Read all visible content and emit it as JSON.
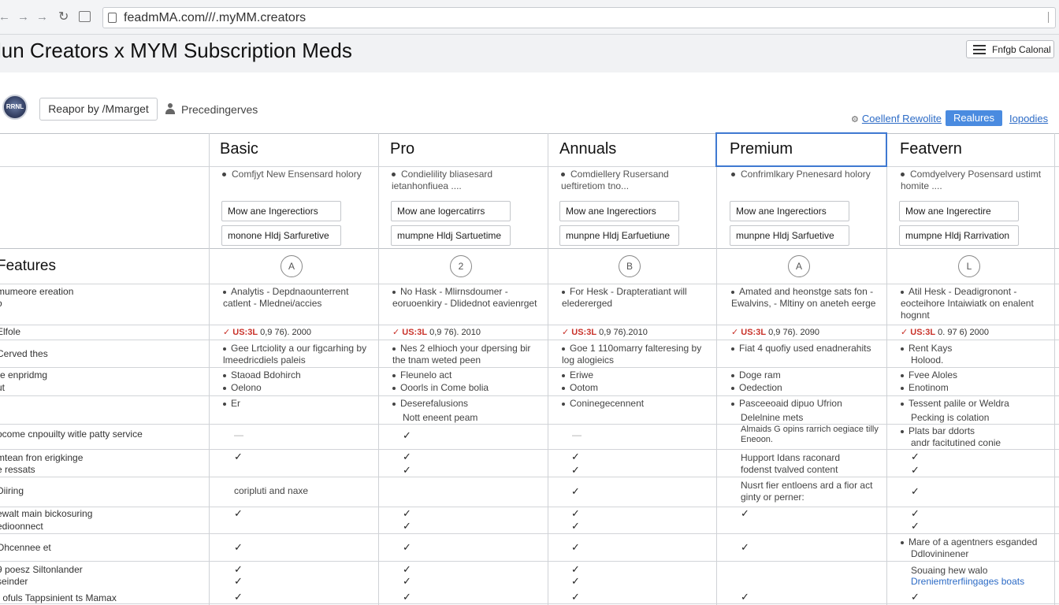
{
  "browser": {
    "url": "feadmMA.com///.myMM.creators",
    "nav_back": "←",
    "nav_forward": "→",
    "nav_forward2": "→",
    "nav_reload": "↻"
  },
  "header": {
    "title": "lun Creators x MYM Subscription Meds",
    "export_label": "Fnfgb Calonal"
  },
  "profile": {
    "avatar_text": "RRNL",
    "report_label": "Reapor by /Mmarget",
    "preceding_label": "Precedingerves"
  },
  "toolbar": {
    "link1": "Coellenf Rewolite",
    "features_tag": "Realures",
    "link3": "Iopodies"
  },
  "plans": [
    {
      "name": "Basic",
      "desc": "Comfjyt New Ensensard holory",
      "btn1": "Mow ane Ingerectiors",
      "btn2": "monone Hldj Sarfuretive",
      "badge": "A"
    },
    {
      "name": "Pro",
      "desc": "Condielility bliasesard ietanhonfiuea ....",
      "btn1": "Mow ane logercatirrs",
      "btn2": "mumpne Hldj Sartuetime",
      "badge": "2"
    },
    {
      "name": "Annuals",
      "desc": "Comdiellery Rusersand ueftiretiom tno...",
      "btn1": "Mow ane Ingerectiors",
      "btn2": "munpne Hldj Earfuetiune",
      "badge": "B"
    },
    {
      "name": "Premium",
      "desc": "Confrimlkary Pnenesard holory",
      "btn1": "Mow ane Ingerectiors",
      "btn2": "munpne Hldj Sarfuetive",
      "badge": "A"
    },
    {
      "name": "Featvern",
      "desc": "Comdyelvery Posensard ustimt homite ....",
      "btn1": "Mow ane Ingerectire",
      "btn2": "mumpne Hldj Rarrivation",
      "badge": "L"
    }
  ],
  "features_heading": "Features",
  "row_labels": [
    "mumeore ereation",
    "o",
    "Elfole",
    "Cerved thes",
    "re enpridmg",
    "ut",
    "ocome cnpouilty witle patty service",
    "mtean fron erigkinge",
    "e ressats",
    "Diiring",
    "ewalt main bickosuring",
    "edioonnect",
    "Ohcennee et",
    "9 poesz Siltonlander",
    "seinder",
    "r ofuls Tappsinient ts Mamax"
  ],
  "cells": {
    "basic": {
      "r1": "Analytis - Depdnaounterrent catlent - Mlednei/accies",
      "price_cur": "US:3L",
      "price_rest": "0,9 76). 2000",
      "r3": "Gee Lrtciolity a our figcarhing by lmeedricdiels paleis",
      "r4": "Staoad Bdohirch",
      "r5": "Oelono",
      "r6": "Er",
      "r7": "—",
      "r9": "coripluti and naxe"
    },
    "pro": {
      "r1": "No Hask - Mlirnsdoumer - eoruoenkiry - Dlidednot eavienrget",
      "price_cur": "US:3L",
      "price_rest": "0,9 76). 2010",
      "r3": "Nes 2 elhioch your dpersing bir the tnam weted peen",
      "r4": "Fleunelo act",
      "r5": "Ooorls in Come bolia",
      "r6": "Deserefalusions",
      "r6b": "Nott eneent peam",
      "r9": ""
    },
    "annuals": {
      "r1": "For Hesk - Drapteratiant will eledererged",
      "price_cur": "US:3L",
      "price_rest": "0,9 76).2010",
      "r3": "Goe 1 110omarry falteresing by log alogieics",
      "r4": "Eriwe",
      "r5": "Ootom",
      "r6": "Coninegecennent",
      "r7": "—"
    },
    "premium": {
      "r1": "Amated and heonstge sats fon - Ewalvins, - Mltiny on aneteh eerge",
      "price_cur": "US:3L",
      "price_rest": "0,9 76). 2090",
      "r3": "Fiat 4 quofiy used enadnerahits",
      "r4": "Doge ram",
      "r5": "Oedection",
      "r6": "Pasceeoaid dipuo Ufrion",
      "r6b": "Delelnine mets",
      "r7": "Almaids G opins rarrich oegiace tilly Eneoon.",
      "r8": "Hupport Idans raconard",
      "r8b": "fodenst tvalved content",
      "r9": "Nusrt fier entloens ard a fior act ginty or perner:"
    },
    "featvern": {
      "r1": "Atil Hesk - Deadigronont - eocteihore Intaiwiatk on enalent hognnt",
      "price_cur": "US:3L",
      "price_rest": "0. 97 6) 2000",
      "r3": "Rent Kays",
      "r3b": "Holood.",
      "r4": "Fvee Aloles",
      "r5": "Enotinom",
      "r6": "Tessent palile or Weldra",
      "r6b": "Pecking is colation",
      "r7": "Plats bar ddorts",
      "r7b": "andr facitutined conie",
      "r12": "Mare of a agentners esganded",
      "r12b": "Ddlovininener",
      "r13": "Souaing hew walo",
      "r14": "Dreniemtrerfiingages boats"
    }
  },
  "check_mark": "✓"
}
